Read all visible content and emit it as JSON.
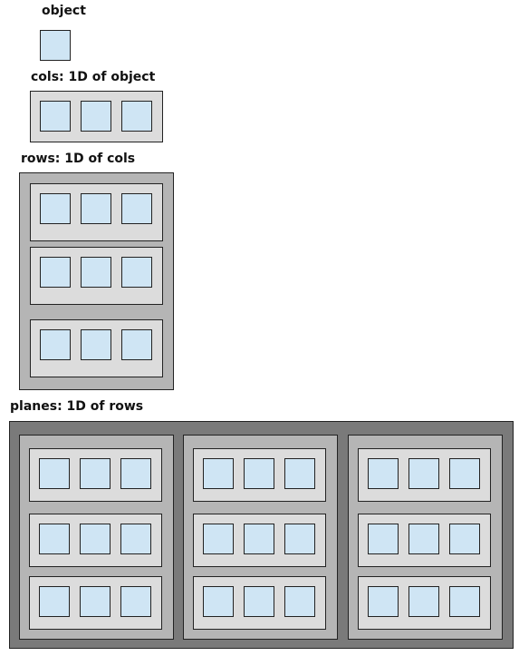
{
  "labels": {
    "object": "object",
    "cols": "cols: 1D of object",
    "rows": "rows: 1D of cols",
    "planes": "planes: 1D of rows"
  },
  "colors": {
    "object_fill": "#cfe5f4",
    "cols_fill": "#dcdcdc",
    "rows_fill": "#b5b5b5",
    "planes_fill": "#7a7a7a",
    "outline": "#222222"
  }
}
